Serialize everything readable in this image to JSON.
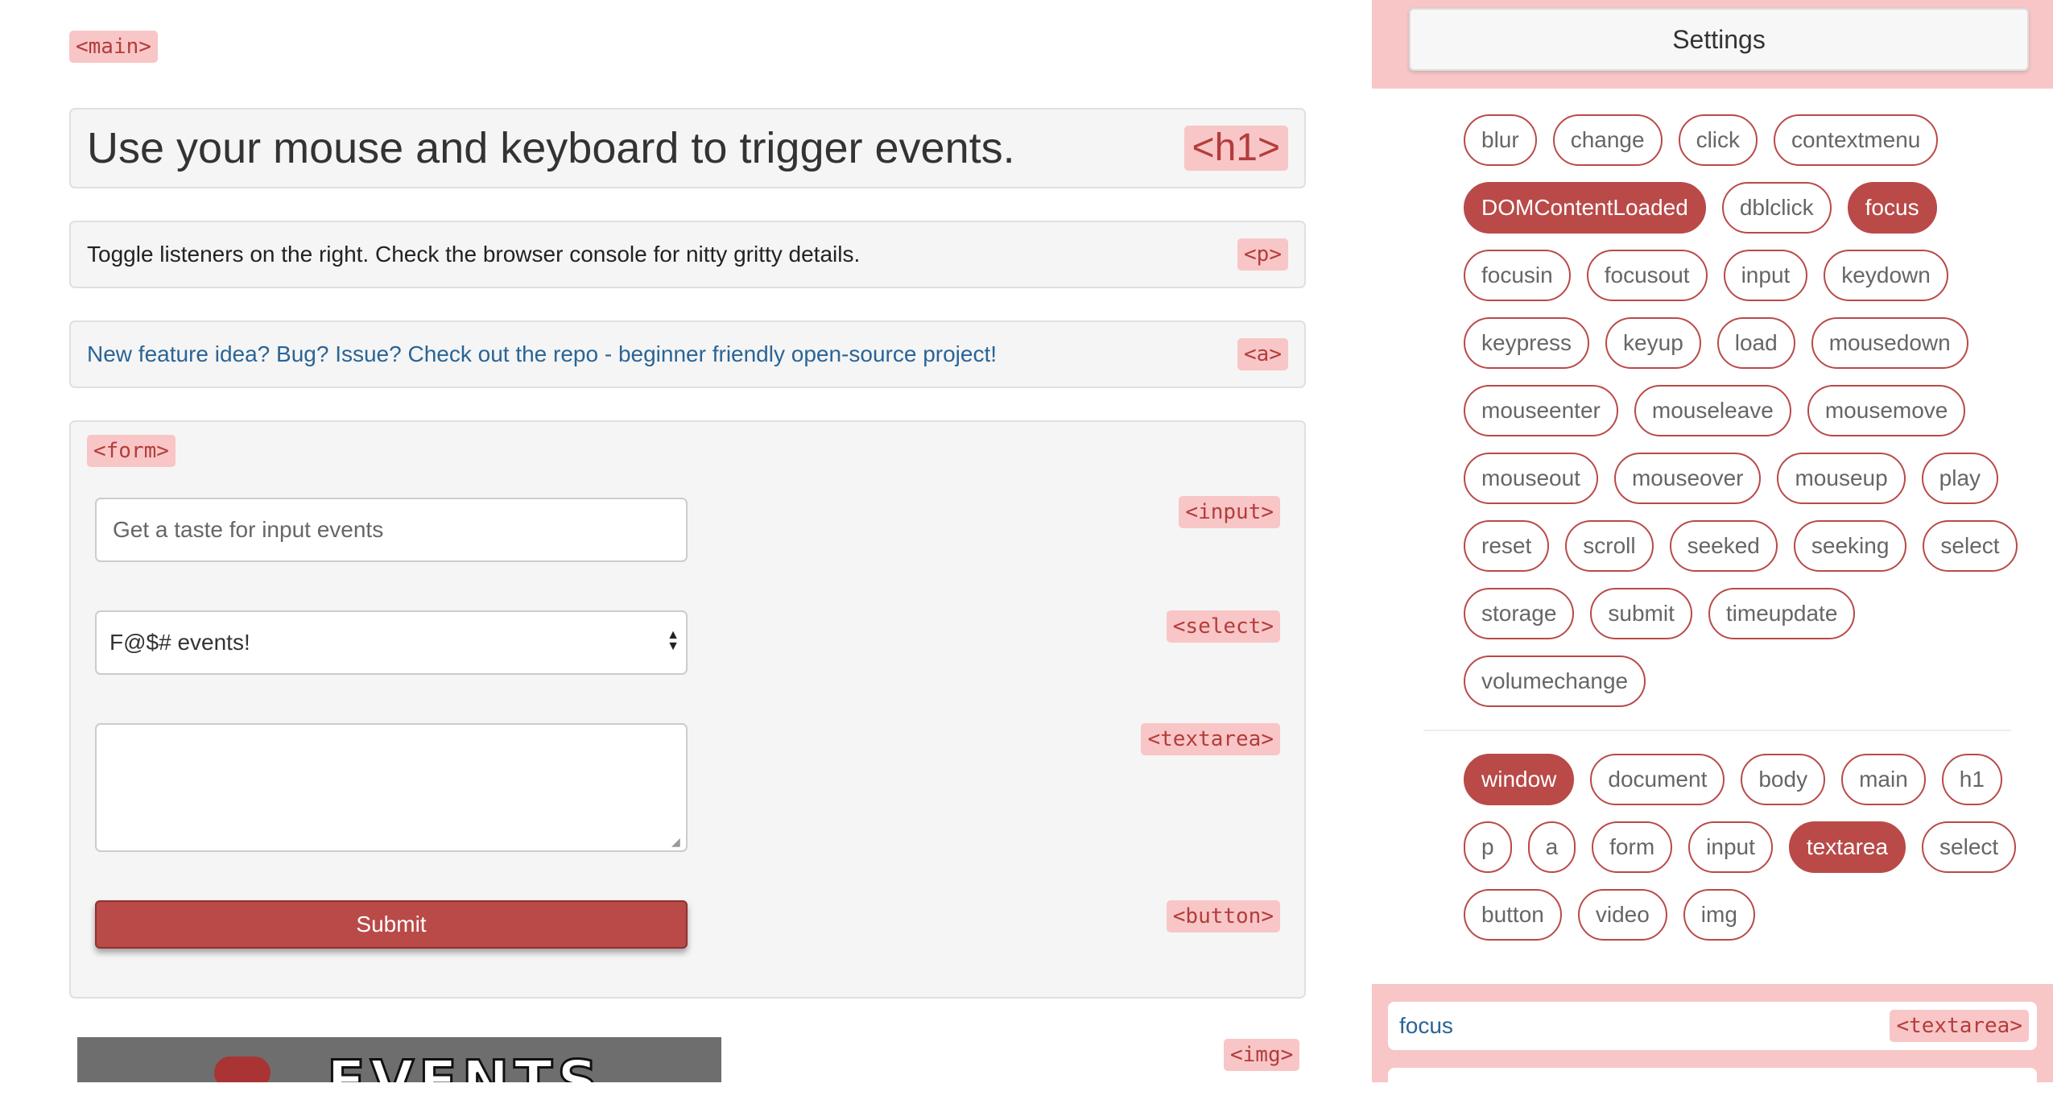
{
  "main": {
    "main_tag": "<main>",
    "heading": "Use your mouse and keyboard to trigger events.",
    "heading_tag": "<h1>",
    "paragraph": "Toggle listeners on the right. Check the browser console for nitty gritty details.",
    "paragraph_tag": "<p>",
    "link": "New feature idea? Bug? Issue? Check out the repo - beginner friendly open-source project!",
    "link_tag": "<a>",
    "img_tag": "<img>",
    "img_caption": "EVENTS"
  },
  "form": {
    "form_tag": "<form>",
    "input_placeholder": "Get a taste for input events",
    "input_tag": "<input>",
    "select_value": "F@$# events!",
    "select_tag": "<select>",
    "textarea_value": "",
    "textarea_tag": "<textarea>",
    "submit_label": "Submit",
    "button_tag": "<button>"
  },
  "sidebar": {
    "settings_label": "Settings",
    "events": [
      {
        "label": "blur",
        "active": false
      },
      {
        "label": "change",
        "active": false
      },
      {
        "label": "click",
        "active": false
      },
      {
        "label": "contextmenu",
        "active": false
      },
      {
        "label": "DOMContentLoaded",
        "active": true
      },
      {
        "label": "dblclick",
        "active": false
      },
      {
        "label": "focus",
        "active": true
      },
      {
        "label": "focusin",
        "active": false
      },
      {
        "label": "focusout",
        "active": false
      },
      {
        "label": "input",
        "active": false
      },
      {
        "label": "keydown",
        "active": false
      },
      {
        "label": "keypress",
        "active": false
      },
      {
        "label": "keyup",
        "active": false
      },
      {
        "label": "load",
        "active": false
      },
      {
        "label": "mousedown",
        "active": false
      },
      {
        "label": "mouseenter",
        "active": false
      },
      {
        "label": "mouseleave",
        "active": false
      },
      {
        "label": "mousemove",
        "active": false
      },
      {
        "label": "mouseout",
        "active": false
      },
      {
        "label": "mouseover",
        "active": false
      },
      {
        "label": "mouseup",
        "active": false
      },
      {
        "label": "play",
        "active": false
      },
      {
        "label": "reset",
        "active": false
      },
      {
        "label": "scroll",
        "active": false
      },
      {
        "label": "seeked",
        "active": false
      },
      {
        "label": "seeking",
        "active": false
      },
      {
        "label": "select",
        "active": false
      },
      {
        "label": "storage",
        "active": false
      },
      {
        "label": "submit",
        "active": false
      },
      {
        "label": "timeupdate",
        "active": false
      },
      {
        "label": "volumechange",
        "active": false
      }
    ],
    "targets": [
      {
        "label": "window",
        "active": true
      },
      {
        "label": "document",
        "active": false
      },
      {
        "label": "body",
        "active": false
      },
      {
        "label": "main",
        "active": false
      },
      {
        "label": "h1",
        "active": false
      },
      {
        "label": "p",
        "active": false
      },
      {
        "label": "a",
        "active": false
      },
      {
        "label": "form",
        "active": false
      },
      {
        "label": "input",
        "active": false
      },
      {
        "label": "textarea",
        "active": true
      },
      {
        "label": "select",
        "active": false
      },
      {
        "label": "button",
        "active": false
      },
      {
        "label": "video",
        "active": false
      },
      {
        "label": "img",
        "active": false
      }
    ],
    "log": [
      {
        "event": "focus",
        "target": "<textarea>"
      }
    ]
  },
  "colors": {
    "accent": "#b94a48",
    "tag_background": "#f8c6c6",
    "link": "#2a6496"
  }
}
